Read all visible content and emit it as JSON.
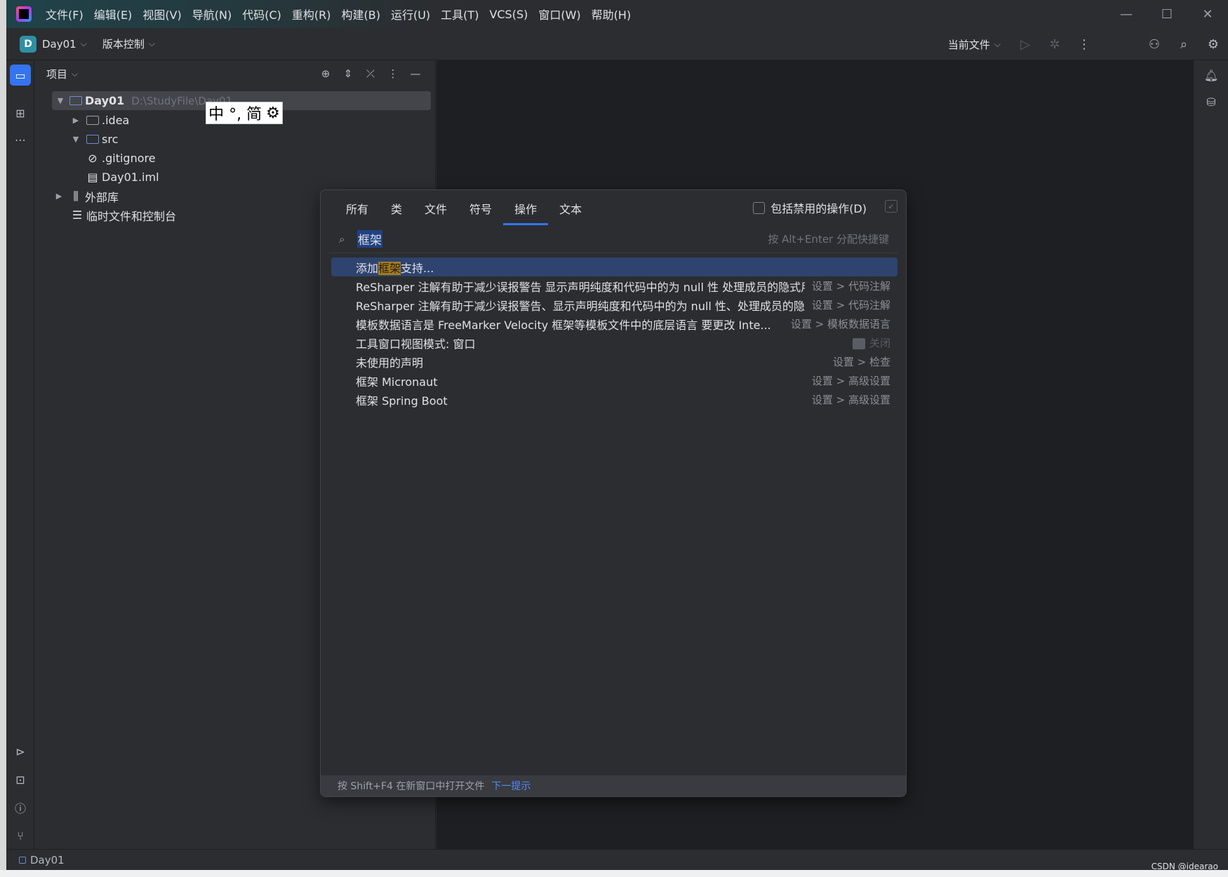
{
  "menubar": {
    "items": [
      "文件(F)",
      "编辑(E)",
      "视图(V)",
      "导航(N)",
      "代码(C)",
      "重构(R)",
      "构建(B)",
      "运行(U)",
      "工具(T)",
      "VCS(S)",
      "窗口(W)",
      "帮助(H)"
    ],
    "min_glyph": "—",
    "max_glyph": "☐",
    "close_glyph": "✕"
  },
  "toolbar": {
    "project_initial": "D",
    "project_name": "Day01",
    "vcs_label": "版本控制",
    "run_config": "当前文件"
  },
  "project_panel": {
    "title": "项目",
    "tree": {
      "root_name": "Day01",
      "root_path": "D:\\StudyFile\\Day01",
      "idea": ".idea",
      "src": "src",
      "gitignore": ".gitignore",
      "iml": "Day01.iml",
      "external_libs": "外部库",
      "scratches": "临时文件和控制台"
    }
  },
  "ime": {
    "text": "中 °, 简"
  },
  "search_popup": {
    "tabs": [
      "所有",
      "类",
      "文件",
      "符号",
      "操作",
      "文本"
    ],
    "active_tab": "操作",
    "include_disabled_label": "包括禁用的操作(D)",
    "query": "框架",
    "hint": "按 Alt+Enter 分配快捷键",
    "results": [
      {
        "prefix": "添加",
        "match": "框架",
        "suffix": "支持...",
        "meta": ""
      },
      {
        "text": "ReSharper 注解有助于减少误报警告 显示声明纯度和代码中的为 null 性 处理成员的隐式用",
        "meta": "设置 > 代码注解"
      },
      {
        "text": "ReSharper 注解有助于减少误报警告、显示声明纯度和代码中的为 null 性、处理成员的隐式",
        "meta": "设置 > 代码注解"
      },
      {
        "text": "模板数据语言是 FreeMarker Velocity 框架等模板文件中的底层语言 要更改 Inte...",
        "meta": "设置 > 模板数据语言"
      },
      {
        "text": "工具窗口视图模式: 窗口",
        "meta": "关闭"
      },
      {
        "text": "未使用的声明",
        "meta": "设置 > 检查"
      },
      {
        "text": "框架 Micronaut",
        "meta": "设置 > 高级设置"
      },
      {
        "text": "框架 Spring Boot",
        "meta": "设置 > 高级设置"
      }
    ],
    "footer_text": "按 Shift+F4 在新窗口中打开文件",
    "footer_link": "下一提示"
  },
  "statusbar": {
    "project": "Day01"
  },
  "watermark": "CSDN @idearao",
  "colors": {
    "accent": "#3574f0",
    "highlight": "#a87b19",
    "selection": "#2e436e"
  }
}
